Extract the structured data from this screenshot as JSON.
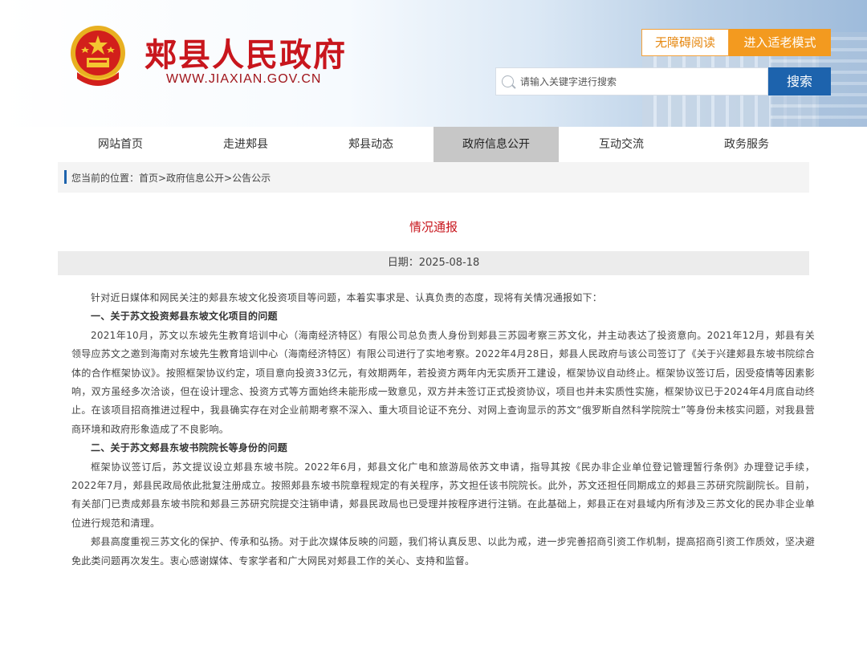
{
  "header": {
    "site_title": "郏县人民政府",
    "site_url": "WWW.JIAXIAN.GOV.CN",
    "accessibility_label": "无障碍阅读",
    "elder_mode_label": "进入适老模式",
    "search_placeholder": "请输入关键字进行搜索",
    "search_button": "搜索"
  },
  "nav": {
    "items": [
      {
        "label": "网站首页"
      },
      {
        "label": "走进郏县"
      },
      {
        "label": "郏县动态"
      },
      {
        "label": "政府信息公开"
      },
      {
        "label": "互动交流"
      },
      {
        "label": "政务服务"
      }
    ],
    "active_index": 3
  },
  "breadcrumb": "您当前的位置：首页>政府信息公开>公告公示",
  "article": {
    "title": "情况通报",
    "date": "日期：2025-08-18",
    "paragraphs": [
      "针对近日媒体和网民关注的郏县东坡文化投资项目等问题，本着实事求是、认真负责的态度，现将有关情况通报如下：",
      "一、关于苏文投资郏县东坡文化项目的问题",
      "2021年10月，苏文以东坡先生教育培训中心（海南经济特区）有限公司总负责人身份到郏县三苏园考察三苏文化，并主动表达了投资意向。2021年12月，郏县有关领导应苏文之邀到海南对东坡先生教育培训中心（海南经济特区）有限公司进行了实地考察。2022年4月28日，郏县人民政府与该公司签订了《关于兴建郏县东坡书院综合体的合作框架协议》。按照框架协议约定，项目意向投资33亿元，有效期两年，若投资方两年内无实质开工建设，框架协议自动终止。框架协议签订后，因受疫情等因素影响，双方虽经多次洽谈，但在设计理念、投资方式等方面始终未能形成一致意见，双方并未签订正式投资协议，项目也并未实质性实施，框架协议已于2024年4月底自动终止。在该项目招商推进过程中，我县确实存在对企业前期考察不深入、重大项目论证不充分、对网上查询显示的苏文“俄罗斯自然科学院院士”等身份未核实问题，对我县营商环境和政府形象造成了不良影响。",
      "二、关于苏文郏县东坡书院院长等身份的问题",
      "框架协议签订后，苏文提议设立郏县东坡书院。2022年6月，郏县文化广电和旅游局依苏文申请，指导其按《民办非企业单位登记管理暂行条例》办理登记手续，2022年7月，郏县民政局依此批复注册成立。按照郏县东坡书院章程规定的有关程序，苏文担任该书院院长。此外，苏文还担任同期成立的郏县三苏研究院副院长。目前，有关部门已责成郏县东坡书院和郏县三苏研究院提交注销申请，郏县民政局也已受理并按程序进行注销。在此基础上，郏县正在对县域内所有涉及三苏文化的民办非企业单位进行规范和清理。",
      "郏县高度重视三苏文化的保护、传承和弘扬。对于此次媒体反映的问题，我们将认真反思、以此为戒，进一步完善招商引资工作机制，提高招商引资工作质效，坚决避免此类问题再次发生。衷心感谢媒体、专家学者和广大网民对郏县工作的关心、支持和监督。"
    ]
  },
  "colors": {
    "brand_red": "#c8161d",
    "brand_blue": "#1d63ad",
    "accent_orange": "#f39a1f"
  }
}
